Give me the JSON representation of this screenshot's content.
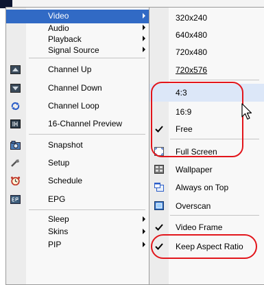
{
  "main_menu": {
    "items": [
      {
        "label": "Video",
        "submenu": true,
        "selected": true,
        "icon": ""
      },
      {
        "label": "Audio",
        "submenu": true,
        "icon": ""
      },
      {
        "label": "Playback",
        "submenu": true,
        "icon": ""
      },
      {
        "label": "Signal Source",
        "submenu": true,
        "icon": ""
      },
      {
        "label": "Channel Up",
        "icon": "channel-up-icon"
      },
      {
        "label": "Channel Down",
        "icon": "channel-down-icon"
      },
      {
        "label": "Channel Loop",
        "icon": "channel-loop-icon"
      },
      {
        "label": "16-Channel Preview",
        "icon": "sixteen-channel-preview-icon"
      },
      {
        "label": "Snapshot",
        "icon": "snapshot-icon"
      },
      {
        "label": "Setup",
        "icon": "setup-icon"
      },
      {
        "label": "Schedule",
        "icon": "schedule-icon"
      },
      {
        "label": "EPG",
        "icon": "epg-icon"
      },
      {
        "label": "Sleep",
        "submenu": true,
        "icon": ""
      },
      {
        "label": "Skins",
        "submenu": true,
        "icon": ""
      },
      {
        "label": "PIP",
        "submenu": true,
        "icon": ""
      }
    ]
  },
  "video_submenu": {
    "items": [
      {
        "label": "320x240"
      },
      {
        "label": "640x480"
      },
      {
        "label": "720x480"
      },
      {
        "label": "720x576"
      },
      {
        "label": "4:3",
        "highlighted": true
      },
      {
        "label": "16:9"
      },
      {
        "label": "Free",
        "checked": true
      },
      {
        "label": "Full Screen",
        "icon": "full-screen-icon"
      },
      {
        "label": "Wallpaper",
        "icon": "wallpaper-icon"
      },
      {
        "label": "Always on Top",
        "icon": "always-on-top-icon"
      },
      {
        "label": "Overscan",
        "icon": "overscan-icon"
      },
      {
        "label": "Video Frame",
        "checked": true
      },
      {
        "label": "Keep Aspect Ratio",
        "checked": true
      }
    ]
  },
  "colors": {
    "selection": "#316ac5",
    "highlight": "#dce7f8",
    "annotation_red": "#e2141a"
  }
}
